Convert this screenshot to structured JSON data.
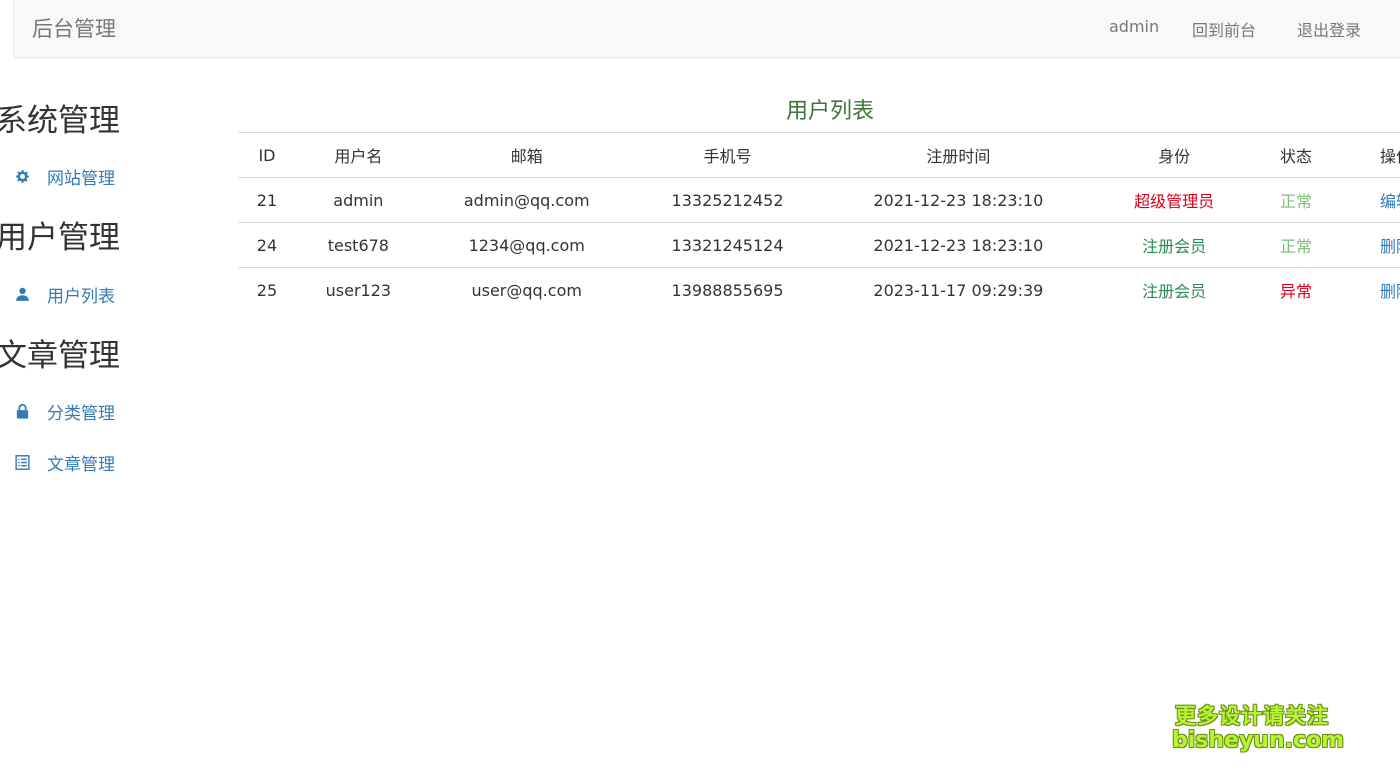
{
  "header": {
    "brand": "后台管理",
    "user": "admin",
    "frontend_link": "回到前台",
    "logout": "退出登录"
  },
  "sidebar": {
    "sections": [
      {
        "title": "系统管理",
        "items": [
          {
            "label": "网站管理",
            "icon": "gear-icon"
          }
        ]
      },
      {
        "title": "用户管理",
        "items": [
          {
            "label": "用户列表",
            "icon": "user-icon"
          }
        ]
      },
      {
        "title": "文章管理",
        "items": [
          {
            "label": "分类管理",
            "icon": "lock-icon"
          },
          {
            "label": "文章管理",
            "icon": "list-icon"
          }
        ]
      }
    ]
  },
  "main": {
    "title": "用户列表",
    "columns": [
      "ID",
      "用户名",
      "邮箱",
      "手机号",
      "注册时间",
      "身份",
      "状态",
      "操作"
    ],
    "rows": [
      {
        "id": "21",
        "username": "admin",
        "email": "admin@qq.com",
        "phone": "13325212452",
        "registered": "2021-12-23 18:23:10",
        "role": "超级管理员",
        "status": "正常",
        "action": "编辑"
      },
      {
        "id": "24",
        "username": "test678",
        "email": "1234@qq.com",
        "phone": "13321245124",
        "registered": "2021-12-23 18:23:10",
        "role": "注册会员",
        "status": "正常",
        "action": "删除"
      },
      {
        "id": "25",
        "username": "user123",
        "email": "user@qq.com",
        "phone": "13988855695",
        "registered": "2023-11-17 09:29:39",
        "role": "注册会员",
        "status": "异常",
        "action": "删除"
      }
    ]
  },
  "watermark": {
    "line1": "更多设计请关注",
    "line2": "bisheyun.com"
  },
  "colors": {
    "link": "#337ab7",
    "title_green": "#3c763d",
    "role_super": "#d9001b",
    "role_member": "#2e8b57",
    "status_ok": "#7cbf7c",
    "status_bad": "#e0001c"
  }
}
